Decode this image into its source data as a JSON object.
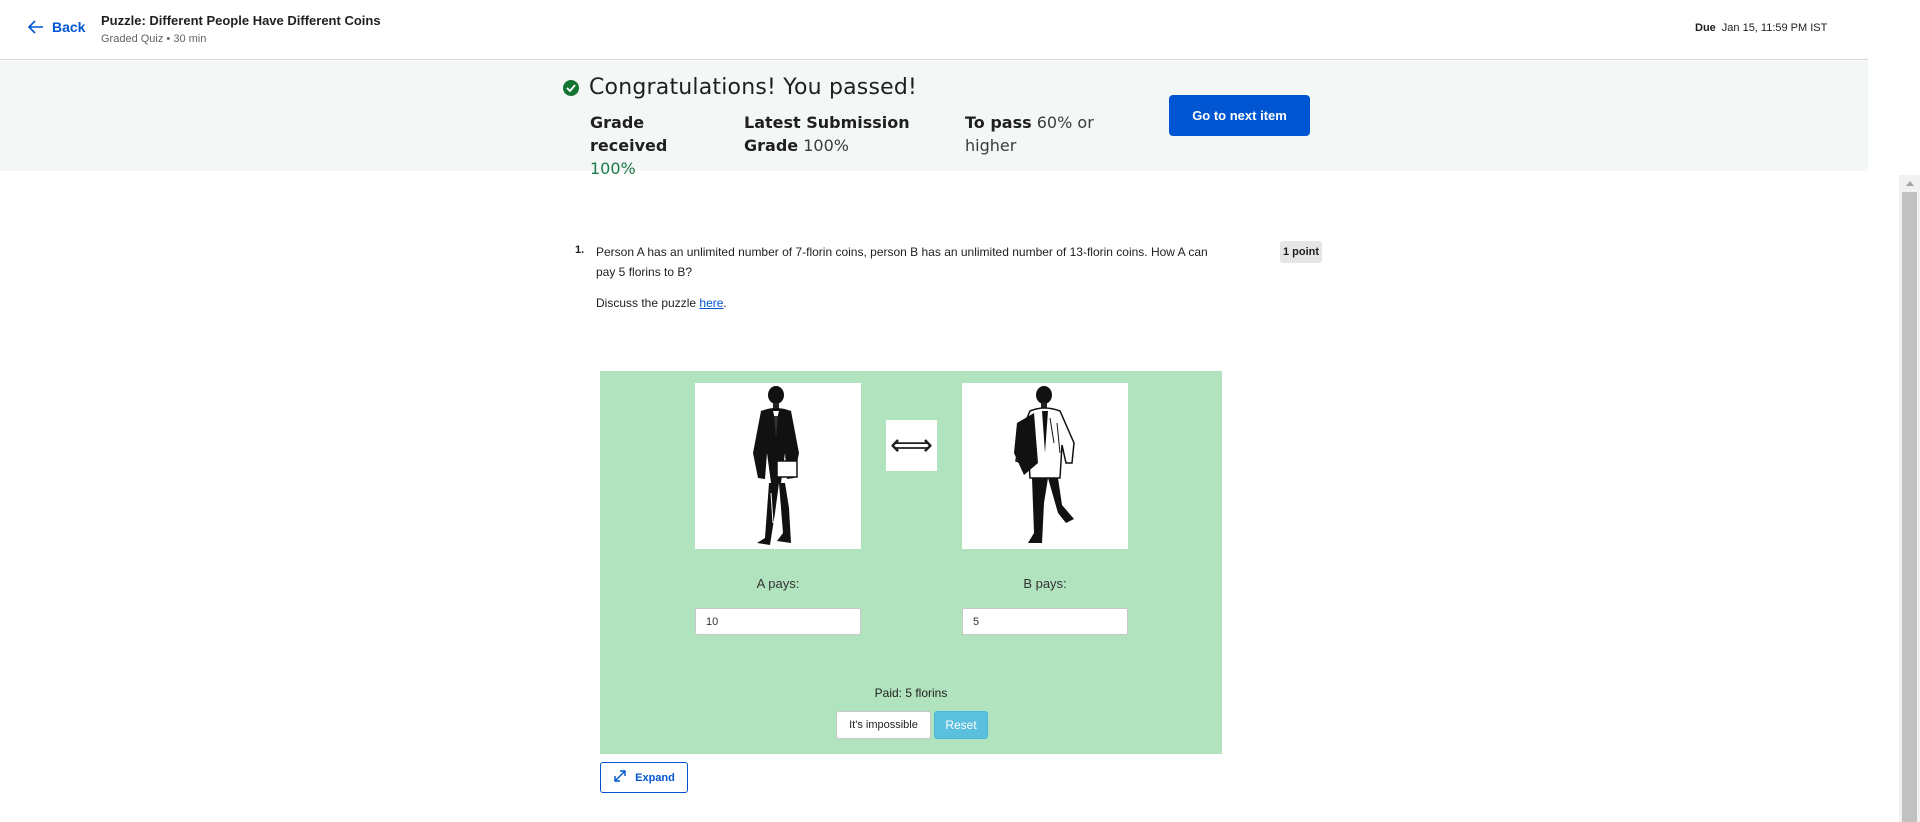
{
  "header": {
    "back_label": "Back",
    "title": "Puzzle: Different People Have Different Coins",
    "subtitle": "Graded Quiz • 30 min",
    "due_label": "Due",
    "due_value": "Jan 15, 11:59 PM IST"
  },
  "banner": {
    "congrats": "Congratulations! You passed!",
    "grade_label_1": "Grade",
    "grade_label_2": "received",
    "grade_value": "100%",
    "latest_label_1": "Latest Submission",
    "latest_label_2": "Grade",
    "latest_value": "100%",
    "pass_label": "To pass",
    "pass_value_1": "60% or",
    "pass_value_2": "higher",
    "next_button": "Go to next item",
    "colors": {
      "success": "#137333",
      "grade_green": "#1d7a49",
      "accent": "#0056d2"
    }
  },
  "question": {
    "number": "1.",
    "text": "Person A has an unlimited number of 7-florin coins, person B has an unlimited number of 13-florin coins. How A can pay 5 florins to B?",
    "discuss_prefix": "Discuss the puzzle ",
    "discuss_link": "here",
    "discuss_suffix": ".",
    "points": "1 point"
  },
  "widget": {
    "arrow": "⟺",
    "a_pays_label": "A pays:",
    "b_pays_label": "B pays:",
    "a_value": "10",
    "b_value": "5",
    "paid_text": "Paid: 5 florins",
    "impossible_button": "It's impossible",
    "reset_button": "Reset",
    "background": "#b2e3bf"
  },
  "expand_button": "Expand"
}
